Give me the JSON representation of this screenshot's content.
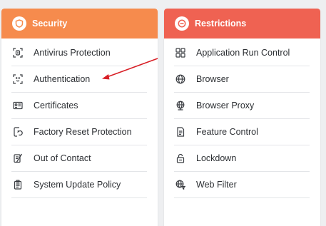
{
  "colors": {
    "security_header": "#f68b4d",
    "restrictions_header": "#ef6252",
    "annotation_arrow": "#d81f26",
    "icon_stroke": "#3a3d42"
  },
  "security": {
    "title": "Security",
    "icon": "shield-icon",
    "items": [
      {
        "label": "Antivirus Protection",
        "icon": "scan-virus-icon"
      },
      {
        "label": "Authentication",
        "icon": "face-scan-icon"
      },
      {
        "label": "Certificates",
        "icon": "certificate-icon"
      },
      {
        "label": "Factory Reset Protection",
        "icon": "reset-icon"
      },
      {
        "label": "Out of Contact",
        "icon": "contact-off-icon"
      },
      {
        "label": "System Update Policy",
        "icon": "clipboard-icon"
      }
    ]
  },
  "restrictions": {
    "title": "Restrictions",
    "icon": "no-entry-icon",
    "items": [
      {
        "label": "Application Run Control",
        "icon": "apps-grid-icon"
      },
      {
        "label": "Browser",
        "icon": "globe-icon"
      },
      {
        "label": "Browser Proxy",
        "icon": "globe-proxy-icon"
      },
      {
        "label": "Feature Control",
        "icon": "document-list-icon"
      },
      {
        "label": "Lockdown",
        "icon": "lock-icon"
      },
      {
        "label": "Web Filter",
        "icon": "globe-filter-icon"
      }
    ]
  }
}
